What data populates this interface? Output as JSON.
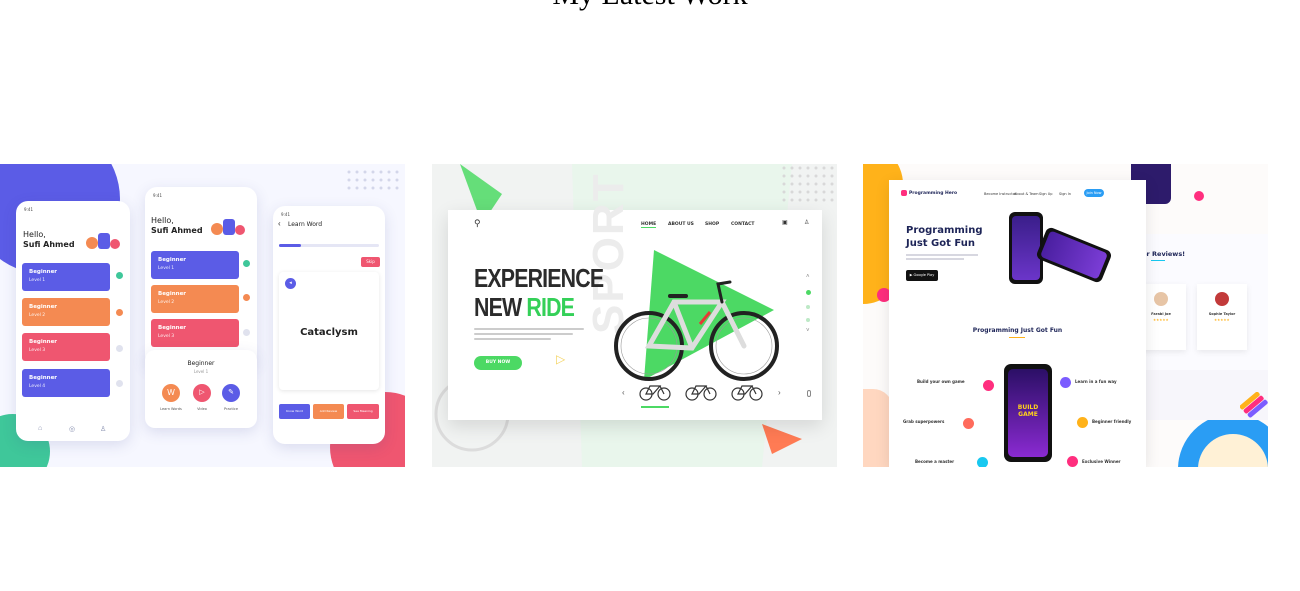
{
  "section": {
    "title": "My Latest Work"
  },
  "projects": [
    {
      "app": {
        "greeting": "Hello,",
        "user": "Sufi Ahmed",
        "levels": [
          {
            "title": "Beginner",
            "sub": "Level 1",
            "color": "#5b5ce6"
          },
          {
            "title": "Beginner",
            "sub": "Level 2",
            "color": "#f48a52"
          },
          {
            "title": "Beginner",
            "sub": "Level 3",
            "color": "#ef5670"
          },
          {
            "title": "Beginner",
            "sub": "Level 4",
            "color": "#5b5ce6"
          }
        ],
        "learn_word": "Learn Word",
        "skip": "Skip",
        "word": "Cataclysm",
        "modal_title": "Beginner",
        "modal_sub": "Level 1",
        "actions": [
          "Learn Words",
          "Video",
          "Practice"
        ],
        "bottom_buttons": [
          "Know Word",
          "Add Review",
          "See Meaning"
        ]
      }
    },
    {
      "bike": {
        "nav": [
          "HOME",
          "ABOUT US",
          "SHOP",
          "CONTACT"
        ],
        "hero_line1": "EXPERIENCE",
        "hero_line2a": "NEW ",
        "hero_line2b": "RIDE",
        "watermark": "SPORT",
        "cta": "BUY NOW"
      }
    },
    {
      "prog": {
        "brand": "Programming Hero",
        "nav": [
          "Become Instructor",
          "About & Team",
          "Sign Up",
          "Sign In",
          "Join Now"
        ],
        "hero": "Programming Just Got Fun",
        "section": "Programming Just Got Fun",
        "features_left": [
          "Build your own game",
          "Grab superpowers",
          "Become a master"
        ],
        "features_right": [
          "Learn in a fun way",
          "Beginner friendly",
          "Exclusive Winner"
        ],
        "reviews_title": "User Reviews!",
        "reviewers": [
          "Farabi Joe",
          "Sophie Taylor"
        ],
        "game": "BUILD GAME"
      }
    }
  ]
}
